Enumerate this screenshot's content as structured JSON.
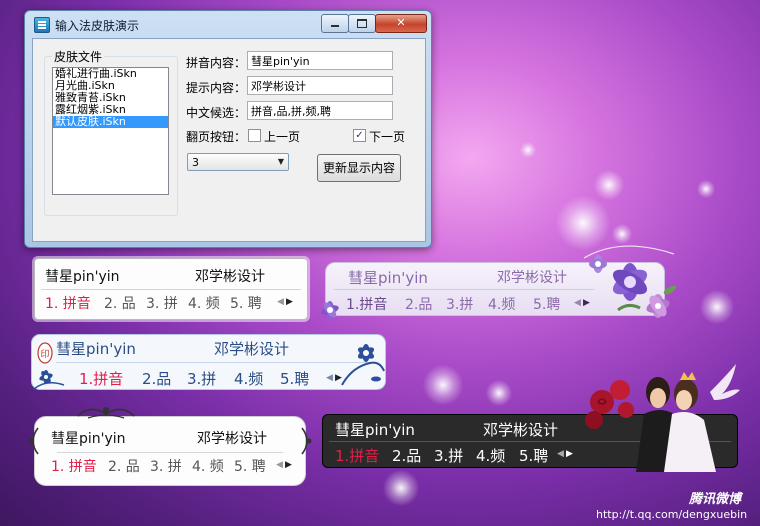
{
  "window": {
    "title": "输入法皮肤演示",
    "group_label": "皮肤文件",
    "skin_files": [
      "婚礼进行曲.iSkn",
      "月光曲.iSkn",
      "雅致青苔.iSkn",
      "露红烟紫.iSkn",
      "默认皮肤.iSkn"
    ],
    "selected_index": 4,
    "pinyin_label": "拼音内容：",
    "pinyin_value": "彗星pin'yin",
    "hint_label": "提示内容：",
    "hint_value": "邓学彬设计",
    "candidates_label": "中文候选：",
    "candidates_value": "拼音,品,拼,频,聘",
    "page_buttons_label": "翻页按钮：",
    "prev_label": "上一页",
    "prev_checked": false,
    "next_label": "下一页",
    "next_checked": true,
    "combo_value": "3",
    "refresh_button": "更新显示内容"
  },
  "skins": {
    "pinyin": "彗星pin'yin",
    "hint": "邓学彬设计",
    "candidates": [
      "1.拼音",
      "2.品",
      "3.拼",
      "4.频",
      "5.聘"
    ],
    "candidates_spaced": [
      "1. 拼音",
      "2. 品",
      "3. 拼",
      "4. 频",
      "5. 聘"
    ],
    "colors": {
      "highlight_red": "#e0204a",
      "purple_text": "#7d5a9e",
      "blue_text": "#2a4d86",
      "dark_bg": "#2a2a2a"
    }
  },
  "watermark": {
    "brand": "腾讯微博",
    "url": "http://t.qq.com/dengxuebin"
  }
}
